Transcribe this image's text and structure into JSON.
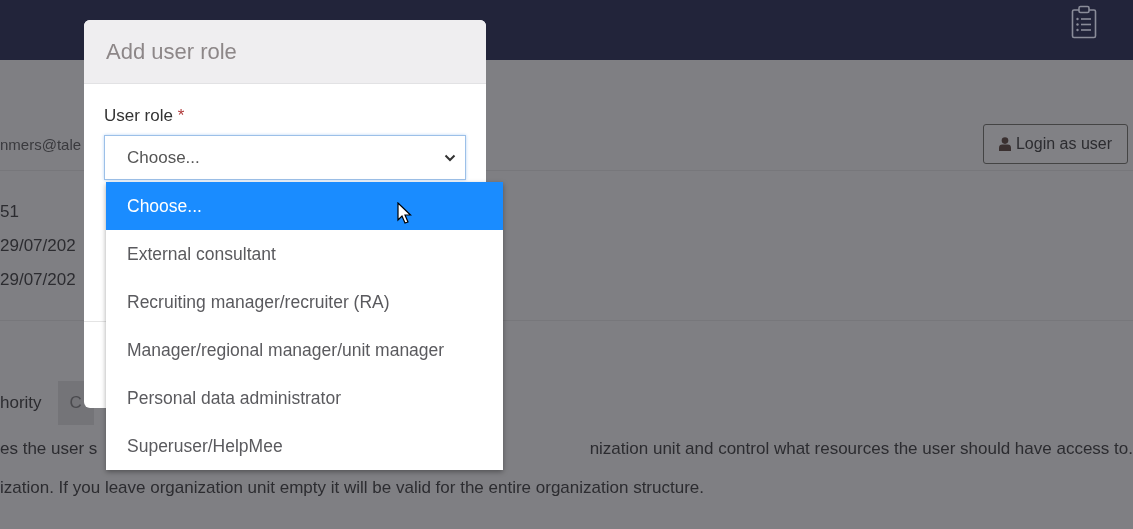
{
  "page": {
    "email": "nmers@tale",
    "login_button": "Login as user",
    "details": [
      "51",
      "29/07/202",
      "29/07/202"
    ],
    "tabs": [
      {
        "label": "hority",
        "selected": false
      },
      {
        "label": "C",
        "selected": true
      }
    ],
    "description": [
      "es the user s",
      "nization unit and control what resources the user should have access to.",
      "ization. If you leave organization unit empty it will be valid for the entire organization structure."
    ]
  },
  "dialog": {
    "title": "Add user role",
    "field": {
      "label": "User role",
      "required_mark": "*",
      "value": "Choose...",
      "expanded": true,
      "options": [
        {
          "label": "Choose...",
          "selected": true
        },
        {
          "label": "External consultant",
          "selected": false
        },
        {
          "label": "Recruiting manager/recruiter (RA)",
          "selected": false
        },
        {
          "label": "Manager/regional manager/unit manager",
          "selected": false
        },
        {
          "label": "Personal data administrator",
          "selected": false
        },
        {
          "label": "Superuser/HelpMee",
          "selected": false
        }
      ]
    }
  }
}
